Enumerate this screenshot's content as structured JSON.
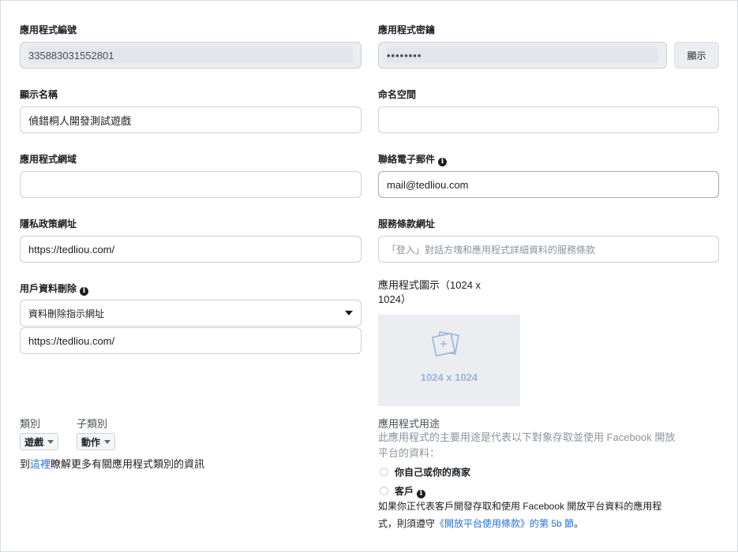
{
  "app_id": {
    "label": "應用程式編號",
    "value": "335883031552801"
  },
  "app_secret": {
    "label": "應用程式密鑰",
    "value": "••••••••",
    "show_button": "顯示"
  },
  "display_name": {
    "label": "顯示名稱",
    "value": "偵錯桐人開發測試遊戲"
  },
  "namespace": {
    "label": "命名空間",
    "value": ""
  },
  "app_domain": {
    "label": "應用程式網域",
    "value": ""
  },
  "contact_email": {
    "label": "聯絡電子郵件",
    "value": "mail@tedliou.com"
  },
  "privacy_url": {
    "label": "隱私政策網址",
    "value": "https://tedliou.com/"
  },
  "tos_url": {
    "label": "服務條款網址",
    "placeholder": "「登入」對話方塊和應用程式詳細資料的服務條款"
  },
  "data_deletion": {
    "label": "用戶資料刪除",
    "select_value": "資料刪除指示網址",
    "url_value": "https://tedliou.com/"
  },
  "app_icon": {
    "label_line1": "應用程式圖示（1024 x",
    "label_line2": "1024）",
    "placeholder_text": "1024 x 1024"
  },
  "category": {
    "label": "類別",
    "value": "遊戲",
    "sub_label": "子類別",
    "sub_value": "動作",
    "help_prefix": "到",
    "help_link": "這裡",
    "help_suffix": "瞭解更多有關應用程式類別的資訊"
  },
  "app_purpose": {
    "label": "應用程式用途",
    "desc_line1": "此應用程式的主要用途是代表以下對象存取並使用 Facebook 開放",
    "desc_line2": "平台的資料：",
    "option1": "你自己或你的商家",
    "option2": "客戶",
    "note_line1": "如果你正代表客戶開發存取和使用 Facebook 開放平台資料的應用程",
    "note_line2_prefix": "式，則須遵守",
    "note_link": "《開放平台使用條款》的第 5b 節",
    "note_suffix": "。"
  },
  "colors": {
    "link": "#216fdb",
    "border": "#ccd0d5",
    "readonly_bg": "#ebedf0"
  }
}
